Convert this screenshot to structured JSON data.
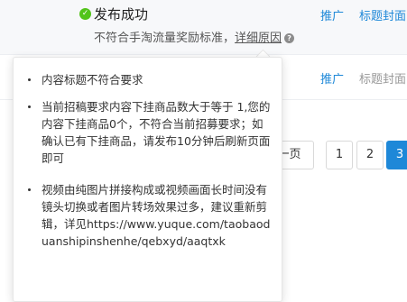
{
  "row1": {
    "status": "发布成功",
    "reason": "不符合手淘流量奖励标准，",
    "detail_link": "详细原因",
    "actions": [
      "推广",
      "标题封面"
    ]
  },
  "row2": {
    "actions": [
      "推广",
      "标题封面"
    ]
  },
  "popover": {
    "items": [
      "内容标题不符合要求",
      "当前招稿要求内容下挂商品数大于等于 1,您的内容下挂商品0个，不符合当前招募要求；如确认已有下挂商品，请发布10分钟后刷新页面即可",
      "视频由纯图片拼接构成或视频画面长时间没有镜头切换或者图片转场效果过多，建议重新剪辑，详见https://www.yuque.com/taobaoduanshipinshenhe/qebxyd/aaqtxk"
    ]
  },
  "pagination": {
    "prev_label": "上一页",
    "pages": [
      "1",
      "2",
      "3"
    ],
    "current": "3"
  },
  "colors": {
    "accent": "#1e88d8",
    "success": "#52c41a"
  },
  "icons": [
    "check-circle-icon",
    "question-circle-icon"
  ]
}
